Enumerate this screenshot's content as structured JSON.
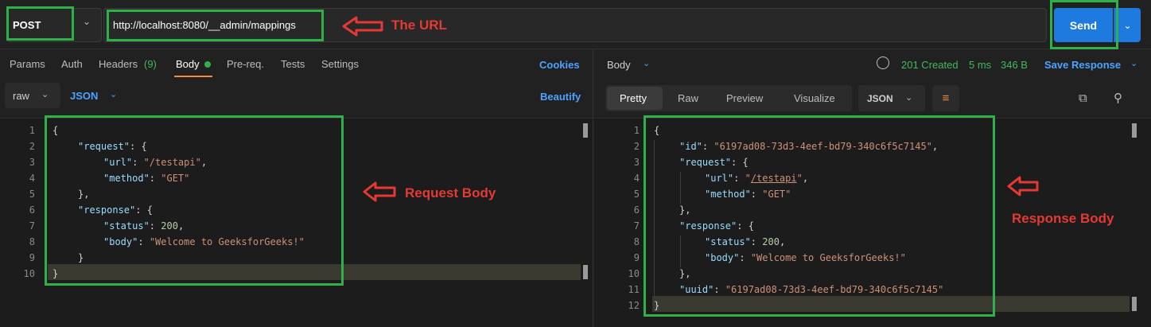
{
  "request": {
    "method": "POST",
    "url": "http://localhost:8080/__admin/mappings",
    "send_label": "Send"
  },
  "annotations": {
    "url": "The URL",
    "request_body": "Request Body",
    "response_body": "Response Body"
  },
  "request_tabs": [
    {
      "label": "Params"
    },
    {
      "label": "Auth"
    },
    {
      "label": "Headers",
      "count": "(9)"
    },
    {
      "label": "Body",
      "active": true
    },
    {
      "label": "Pre-req."
    },
    {
      "label": "Tests"
    },
    {
      "label": "Settings"
    }
  ],
  "cookies_label": "Cookies",
  "body_mode": "raw",
  "body_format": "JSON",
  "beautify_label": "Beautify",
  "request_body_lines": [
    "1",
    "2",
    "3",
    "4",
    "5",
    "6",
    "7",
    "8",
    "9",
    "10"
  ],
  "request_code": {
    "request_key": "\"request\"",
    "url_key": "\"url\"",
    "url_val": "\"/testapi\"",
    "method_key": "\"method\"",
    "method_val": "\"GET\"",
    "response_key": "\"response\"",
    "status_key": "\"status\"",
    "status_val": "200",
    "body_key": "\"body\"",
    "body_val": "\"Welcome to GeeksforGeeks!\""
  },
  "response": {
    "section_label": "Body",
    "status": "201 Created",
    "time": "5 ms",
    "size": "346 B",
    "save_label": "Save Response",
    "view_tabs": [
      "Pretty",
      "Raw",
      "Preview",
      "Visualize"
    ],
    "format": "JSON",
    "lines": [
      "1",
      "2",
      "3",
      "4",
      "5",
      "6",
      "7",
      "8",
      "9",
      "10",
      "11",
      "12"
    ],
    "code": {
      "id_key": "\"id\"",
      "id_val": "\"6197ad08-73d3-4eef-bd79-340c6f5c7145\"",
      "request_key": "\"request\"",
      "url_key": "\"url\"",
      "url_val": "/testapi",
      "method_key": "\"method\"",
      "method_val": "\"GET\"",
      "response_key": "\"response\"",
      "status_key": "\"status\"",
      "status_val": "200",
      "body_key": "\"body\"",
      "body_val": "\"Welcome to GeeksforGeeks!\"",
      "uuid_key": "\"uuid\"",
      "uuid_val": "\"6197ad08-73d3-4eef-bd79-340c6f5c7145\""
    }
  },
  "colors": {
    "accent": "#1f7ae0",
    "annotation_box": "#2fb14a",
    "annotation_text": "#e53935"
  }
}
